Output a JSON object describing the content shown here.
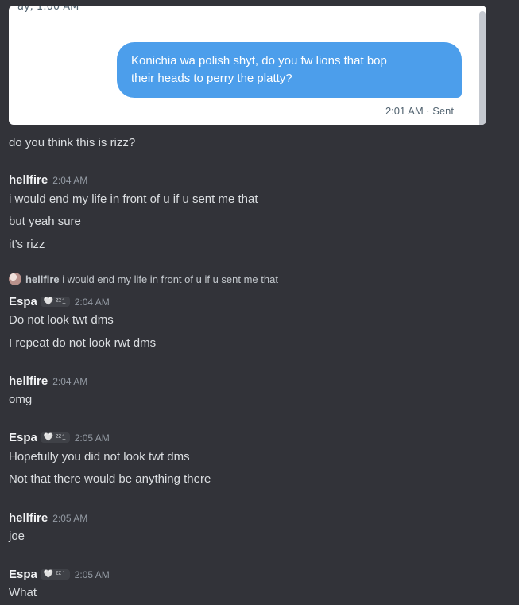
{
  "embed": {
    "timestamp_partial": "ay, 1:00 AM",
    "bubble_lines": [
      "Konichia wa polish shyt, do you fw lions that bop",
      "their heads to perry the platty?"
    ],
    "time": "2:01 AM",
    "separator": "·",
    "status": "Sent"
  },
  "messages": [
    {
      "text": "do you think this is rizz?"
    },
    {
      "user": "hellfire",
      "time": "2:04 AM",
      "lines": [
        "i would end my life in front of u if u sent me that",
        "but yeah sure",
        "it’s rizz"
      ]
    },
    {
      "reply_user": "hellfire",
      "reply_text": "i would end my life in front of u if u sent me that"
    },
    {
      "user": "Espa",
      "badge": "🤍 ᶻᶻ𝟷",
      "time": "2:04 AM",
      "lines": [
        "Do not look twt dms",
        "I repeat do not look rwt dms"
      ]
    },
    {
      "user": "hellfire",
      "time": "2:04 AM",
      "lines": [
        "omg"
      ]
    },
    {
      "user": "Espa",
      "badge": "🤍 ᶻᶻ𝟷",
      "time": "2:05 AM",
      "lines": [
        "Hopefully you did not look twt dms",
        "Not that there would be anything there"
      ]
    },
    {
      "user": "hellfire",
      "time": "2:05 AM",
      "lines": [
        "joe"
      ]
    },
    {
      "user": "Espa",
      "badge": "🤍 ᶻᶻ𝟷",
      "time": "2:05 AM",
      "lines": [
        "What"
      ]
    }
  ]
}
